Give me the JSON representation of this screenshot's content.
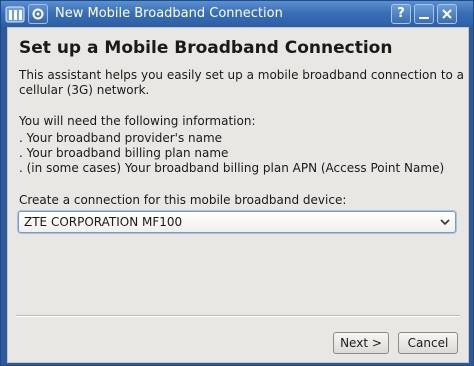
{
  "window": {
    "title": "New Mobile Broadband Connection",
    "controls": {
      "help": "?",
      "minimize": "_",
      "close": "×"
    }
  },
  "page": {
    "heading": "Set up a Mobile Broadband Connection",
    "intro_line1": "This assistant helps you easily set up a mobile broadband connection to a",
    "intro_line2": "cellular (3G) network.",
    "need_info": "You will need the following information:",
    "items": [
      ". Your broadband provider's name",
      ". Your broadband billing plan name",
      ". (in some cases) Your broadband billing plan APN (Access Point Name)"
    ],
    "device_label": "Create a connection for this mobile broadband device:",
    "device_selected": "ZTE CORPORATION MF100"
  },
  "buttons": {
    "next": "Next >",
    "cancel": "Cancel"
  },
  "colors": {
    "titlebar": "#3a6fb6",
    "dialog_bg": "#e9e7e4",
    "focus": "#a9c2e2"
  }
}
